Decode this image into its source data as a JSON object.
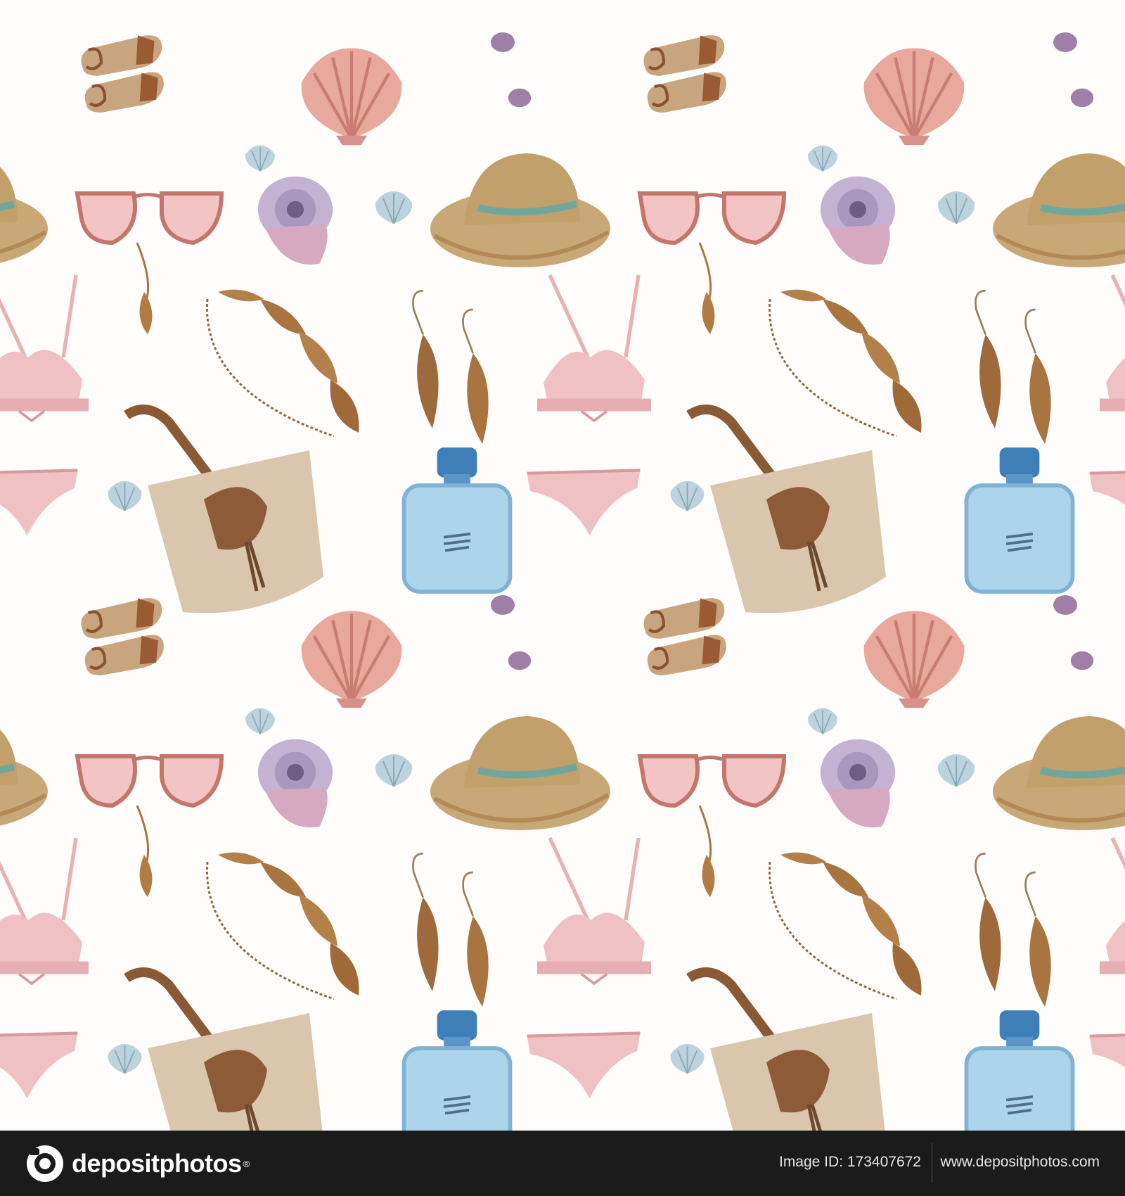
{
  "footer": {
    "logo_text": "depositphotos",
    "logo_reg": "®",
    "image_id_label": "Image ID:",
    "image_id": "173407672",
    "site_url": "www.depositphotos.com"
  },
  "colors": {
    "background": "#ffffff",
    "footer": "#1b1b1b",
    "straw": "#c9a877",
    "leather": "#9a5a33",
    "blush": "#eec0c3",
    "perfume_blue": "#a9d3ea",
    "shell_pink": "#e8a99c",
    "shell_lilac": "#b7a5c5"
  },
  "pattern": {
    "tiles": 3,
    "icons": [
      "straw-hat-icon",
      "sunglasses-icon",
      "bikini-top-icon",
      "bikini-bottom-icon",
      "straw-bag-icon",
      "sandal-icon",
      "scallop-shell-icon",
      "snail-shell-icon",
      "perfume-bottle-icon",
      "feather-earrings-icon",
      "feather-necklace-icon",
      "pebble-icon"
    ]
  }
}
